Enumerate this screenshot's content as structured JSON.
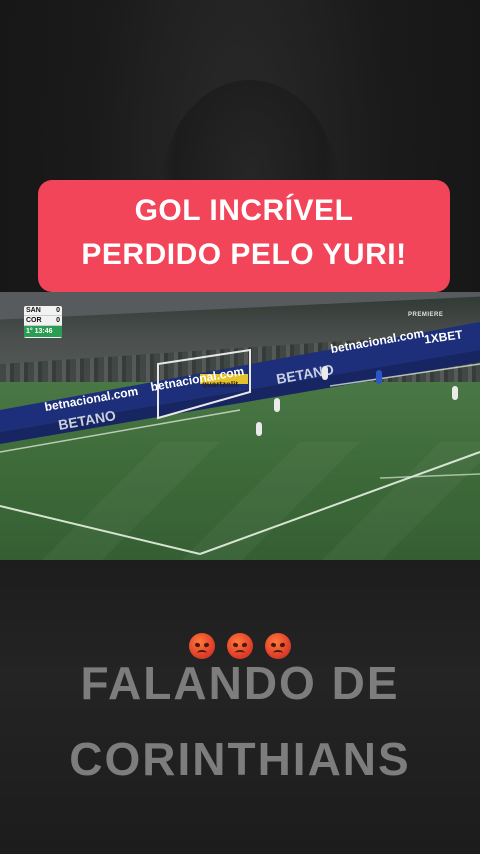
{
  "caption": {
    "line1": "GOL INCRÍVEL",
    "line2": "PERDIDO PELO YURI!"
  },
  "scoreboard": {
    "team1": "SAN",
    "score1": "0",
    "team2": "COR",
    "score2": "0",
    "clock": "1° 13:46"
  },
  "broadcaster": "PREMIERE",
  "ads": [
    "betnacional.com",
    "betnacional.com",
    "betnacional.com",
    "BETANO",
    "BETANO",
    "1XBET",
    "quartzolit"
  ],
  "emojis": [
    "😡",
    "😡",
    "😡"
  ],
  "brand": {
    "line1": "FALANDO DE",
    "line2": "CORINTHIANS"
  },
  "colors": {
    "caption_bg": "#f2455a",
    "pitch": "#3f6c3b",
    "brand_text": "#7d7d7d"
  }
}
